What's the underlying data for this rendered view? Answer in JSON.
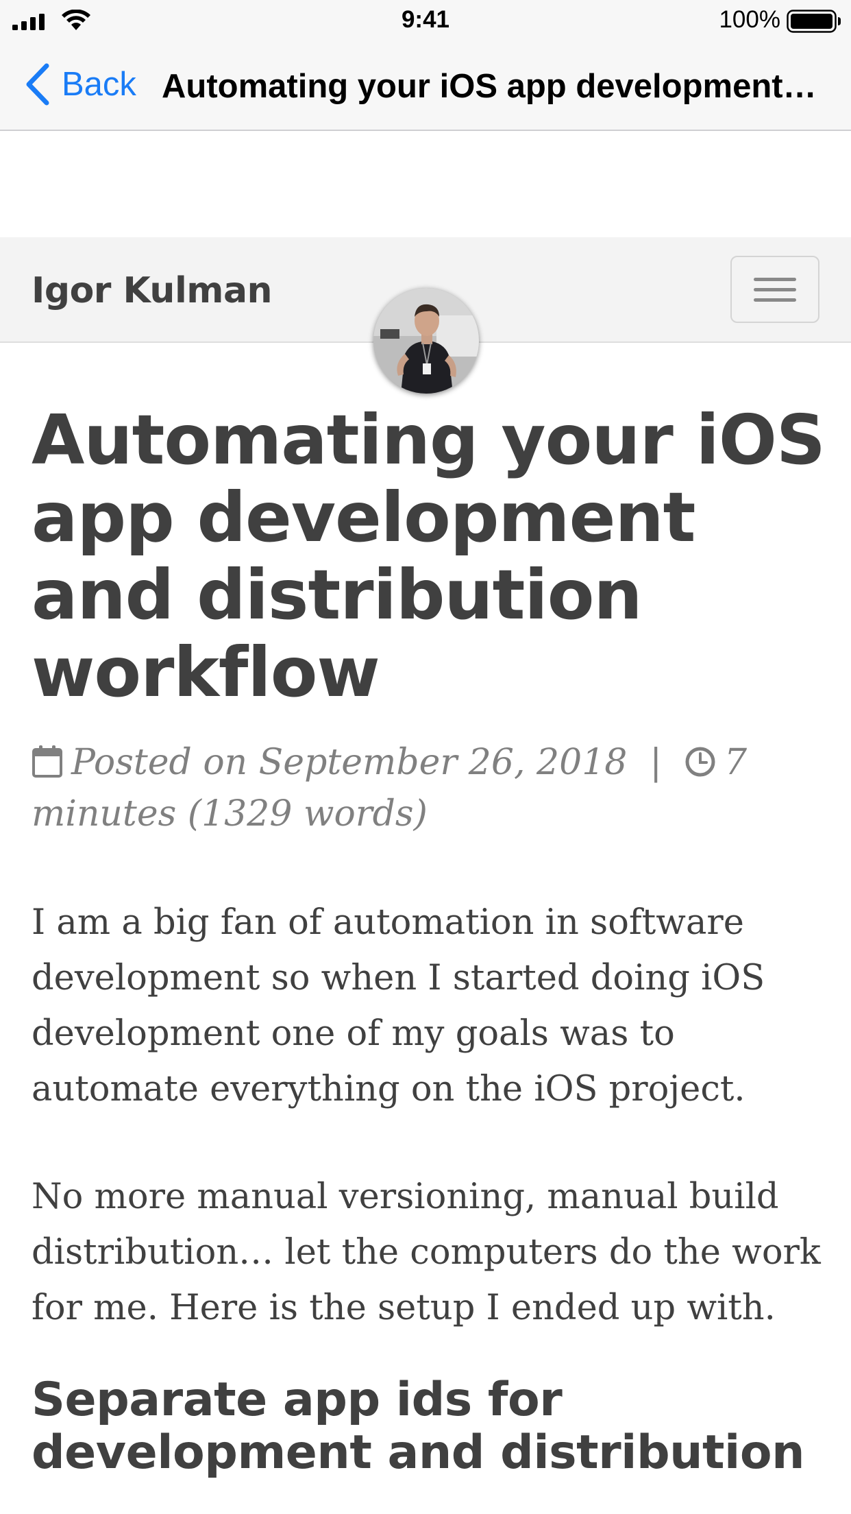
{
  "status_bar": {
    "time": "9:41",
    "battery_percent": "100%",
    "signal_icon": "cellular-signal-icon",
    "wifi_icon": "wifi-icon",
    "battery_icon": "battery-full-icon"
  },
  "nav_bar": {
    "back_label": "Back",
    "title": "Automating your iOS app development…",
    "back_icon": "chevron-left-icon",
    "accent_color": "#1a7cf6"
  },
  "site": {
    "brand": "Igor Kulman",
    "menu_icon": "hamburger-menu-icon",
    "avatar_icon": "profile-photo"
  },
  "article": {
    "title": "Automating your iOS app development and distribution workflow",
    "meta": {
      "posted_on": "Posted on September 26, 2018",
      "separator": "|",
      "reading_time": "7 minutes (1329 words)",
      "calendar_icon": "calendar-icon",
      "clock_icon": "clock-icon"
    },
    "paragraphs": [
      "I am a big fan of automation in software development so when I started doing iOS development one of my goals was to automate everything on the iOS project.",
      "No more manual versioning, manual build distribution… let the computers do the work for me. Here is the setup I ended up with."
    ],
    "section_heading": "Separate app ids for development and distribution"
  }
}
